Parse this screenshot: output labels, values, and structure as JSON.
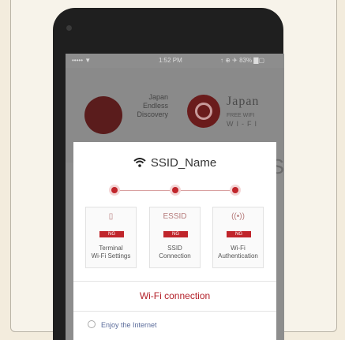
{
  "status_bar": {
    "carrier": "•••••  ▼",
    "time": "1:52 PM",
    "right": "↑ ⊕ ✈ 83% ▇▢"
  },
  "background": {
    "logo_a_lines": [
      "Japan",
      "Endless",
      "Discovery"
    ],
    "logo_b_title": "Japan",
    "logo_b_sub": "FREE WIFI",
    "logo_b_wifi": "WI-FI"
  },
  "modal": {
    "ssid": "SSID_Name",
    "steps": [
      {
        "glyph": "▯",
        "badge": "NG",
        "label_1": "Terminal",
        "label_2": "Wi-Fi Settings"
      },
      {
        "glyph": "ESSID",
        "badge": "NG",
        "label_1": "SSID",
        "label_2": "Connection"
      },
      {
        "glyph": "((•))",
        "badge": "NG",
        "label_1": "Wi-Fi",
        "label_2": "Authentication"
      }
    ],
    "connect_button": "Wi-Fi connection",
    "enjoy_text": "Enjoy the Internet"
  },
  "colors": {
    "accent": "#c0252b",
    "phone": "#1f1f1f",
    "page_bg": "#f3ecdd"
  }
}
